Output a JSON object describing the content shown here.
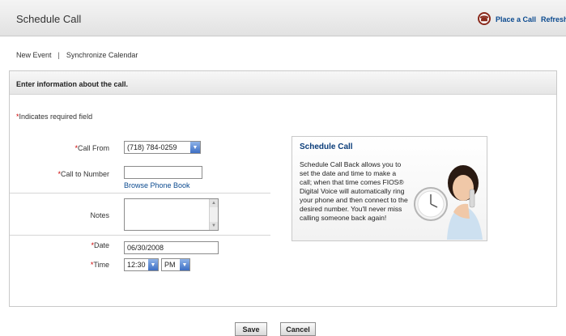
{
  "header": {
    "title": "Schedule Call",
    "place_call": "Place a Call",
    "refresh": "Refresh"
  },
  "subnav": {
    "new_event": "New Event",
    "separator": "|",
    "sync_calendar": "Synchronize Calendar"
  },
  "panel": {
    "heading": "Enter information about the call."
  },
  "form": {
    "required_note": "Indicates required field",
    "required_mark": "*",
    "call_from_label": "Call From",
    "call_from_value": "(718) 784-0259",
    "call_to_label": "Call to Number",
    "call_to_value": "",
    "browse_link": "Browse Phone Book",
    "notes_label": "Notes",
    "notes_value": "",
    "date_label": "Date",
    "date_value": "06/30/2008",
    "time_label": "Time",
    "time_hour": "12:30",
    "time_ampm": "PM"
  },
  "promo": {
    "title": "Schedule Call",
    "body": "Schedule Call Back allows you to set the date and time to make a call; when that time comes FIOS® Digital Voice will automatically ring your phone and then connect to the desired number. You'll never miss calling someone back again!"
  },
  "footer": {
    "save": "Save",
    "cancel": "Cancel"
  }
}
